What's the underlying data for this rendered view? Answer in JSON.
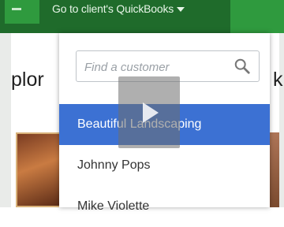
{
  "header": {
    "title": "Go to client's QuickBooks"
  },
  "background": {
    "left_text_fragment": "plor",
    "right_text_fragment": "k"
  },
  "dropdown": {
    "search": {
      "placeholder": "Find a customer",
      "icon": "search-icon"
    },
    "customers": [
      {
        "name": "Beautiful Landscaping",
        "selected": true
      },
      {
        "name": "Johnny Pops",
        "selected": false
      },
      {
        "name": "Mike Violette",
        "selected": false
      }
    ]
  },
  "overlay": {
    "icon": "play-icon"
  },
  "colors": {
    "header_bg": "#1f6b2b",
    "header_accent": "#2f9a3e",
    "selected_row": "#3c71d3"
  }
}
